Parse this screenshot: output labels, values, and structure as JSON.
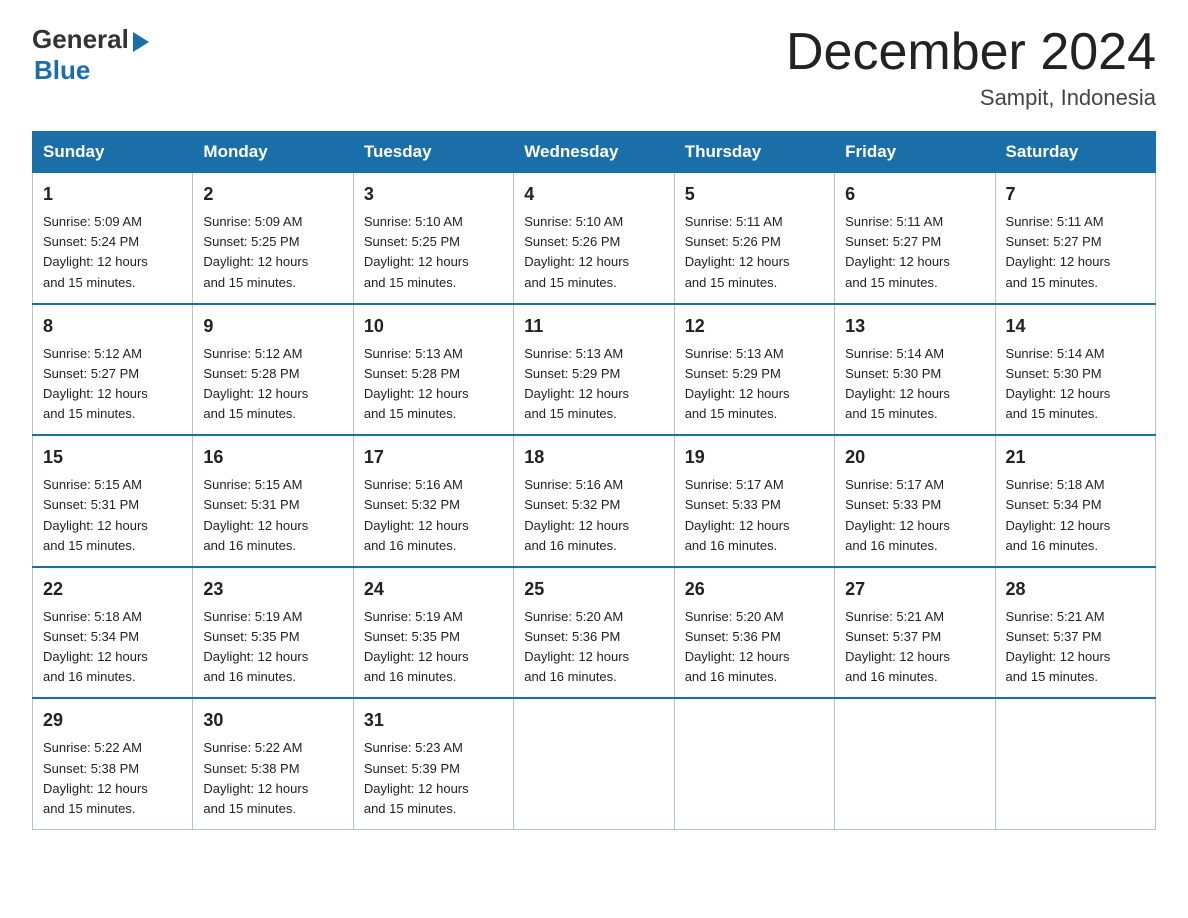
{
  "header": {
    "logo_general": "General",
    "logo_blue": "Blue",
    "month_title": "December 2024",
    "subtitle": "Sampit, Indonesia"
  },
  "days_of_week": [
    "Sunday",
    "Monday",
    "Tuesday",
    "Wednesday",
    "Thursday",
    "Friday",
    "Saturday"
  ],
  "weeks": [
    [
      {
        "day": "1",
        "sunrise": "5:09 AM",
        "sunset": "5:24 PM",
        "daylight": "12 hours and 15 minutes."
      },
      {
        "day": "2",
        "sunrise": "5:09 AM",
        "sunset": "5:25 PM",
        "daylight": "12 hours and 15 minutes."
      },
      {
        "day": "3",
        "sunrise": "5:10 AM",
        "sunset": "5:25 PM",
        "daylight": "12 hours and 15 minutes."
      },
      {
        "day": "4",
        "sunrise": "5:10 AM",
        "sunset": "5:26 PM",
        "daylight": "12 hours and 15 minutes."
      },
      {
        "day": "5",
        "sunrise": "5:11 AM",
        "sunset": "5:26 PM",
        "daylight": "12 hours and 15 minutes."
      },
      {
        "day": "6",
        "sunrise": "5:11 AM",
        "sunset": "5:27 PM",
        "daylight": "12 hours and 15 minutes."
      },
      {
        "day": "7",
        "sunrise": "5:11 AM",
        "sunset": "5:27 PM",
        "daylight": "12 hours and 15 minutes."
      }
    ],
    [
      {
        "day": "8",
        "sunrise": "5:12 AM",
        "sunset": "5:27 PM",
        "daylight": "12 hours and 15 minutes."
      },
      {
        "day": "9",
        "sunrise": "5:12 AM",
        "sunset": "5:28 PM",
        "daylight": "12 hours and 15 minutes."
      },
      {
        "day": "10",
        "sunrise": "5:13 AM",
        "sunset": "5:28 PM",
        "daylight": "12 hours and 15 minutes."
      },
      {
        "day": "11",
        "sunrise": "5:13 AM",
        "sunset": "5:29 PM",
        "daylight": "12 hours and 15 minutes."
      },
      {
        "day": "12",
        "sunrise": "5:13 AM",
        "sunset": "5:29 PM",
        "daylight": "12 hours and 15 minutes."
      },
      {
        "day": "13",
        "sunrise": "5:14 AM",
        "sunset": "5:30 PM",
        "daylight": "12 hours and 15 minutes."
      },
      {
        "day": "14",
        "sunrise": "5:14 AM",
        "sunset": "5:30 PM",
        "daylight": "12 hours and 15 minutes."
      }
    ],
    [
      {
        "day": "15",
        "sunrise": "5:15 AM",
        "sunset": "5:31 PM",
        "daylight": "12 hours and 15 minutes."
      },
      {
        "day": "16",
        "sunrise": "5:15 AM",
        "sunset": "5:31 PM",
        "daylight": "12 hours and 16 minutes."
      },
      {
        "day": "17",
        "sunrise": "5:16 AM",
        "sunset": "5:32 PM",
        "daylight": "12 hours and 16 minutes."
      },
      {
        "day": "18",
        "sunrise": "5:16 AM",
        "sunset": "5:32 PM",
        "daylight": "12 hours and 16 minutes."
      },
      {
        "day": "19",
        "sunrise": "5:17 AM",
        "sunset": "5:33 PM",
        "daylight": "12 hours and 16 minutes."
      },
      {
        "day": "20",
        "sunrise": "5:17 AM",
        "sunset": "5:33 PM",
        "daylight": "12 hours and 16 minutes."
      },
      {
        "day": "21",
        "sunrise": "5:18 AM",
        "sunset": "5:34 PM",
        "daylight": "12 hours and 16 minutes."
      }
    ],
    [
      {
        "day": "22",
        "sunrise": "5:18 AM",
        "sunset": "5:34 PM",
        "daylight": "12 hours and 16 minutes."
      },
      {
        "day": "23",
        "sunrise": "5:19 AM",
        "sunset": "5:35 PM",
        "daylight": "12 hours and 16 minutes."
      },
      {
        "day": "24",
        "sunrise": "5:19 AM",
        "sunset": "5:35 PM",
        "daylight": "12 hours and 16 minutes."
      },
      {
        "day": "25",
        "sunrise": "5:20 AM",
        "sunset": "5:36 PM",
        "daylight": "12 hours and 16 minutes."
      },
      {
        "day": "26",
        "sunrise": "5:20 AM",
        "sunset": "5:36 PM",
        "daylight": "12 hours and 16 minutes."
      },
      {
        "day": "27",
        "sunrise": "5:21 AM",
        "sunset": "5:37 PM",
        "daylight": "12 hours and 16 minutes."
      },
      {
        "day": "28",
        "sunrise": "5:21 AM",
        "sunset": "5:37 PM",
        "daylight": "12 hours and 15 minutes."
      }
    ],
    [
      {
        "day": "29",
        "sunrise": "5:22 AM",
        "sunset": "5:38 PM",
        "daylight": "12 hours and 15 minutes."
      },
      {
        "day": "30",
        "sunrise": "5:22 AM",
        "sunset": "5:38 PM",
        "daylight": "12 hours and 15 minutes."
      },
      {
        "day": "31",
        "sunrise": "5:23 AM",
        "sunset": "5:39 PM",
        "daylight": "12 hours and 15 minutes."
      },
      null,
      null,
      null,
      null
    ]
  ],
  "labels": {
    "sunrise": "Sunrise:",
    "sunset": "Sunset:",
    "daylight": "Daylight:"
  }
}
